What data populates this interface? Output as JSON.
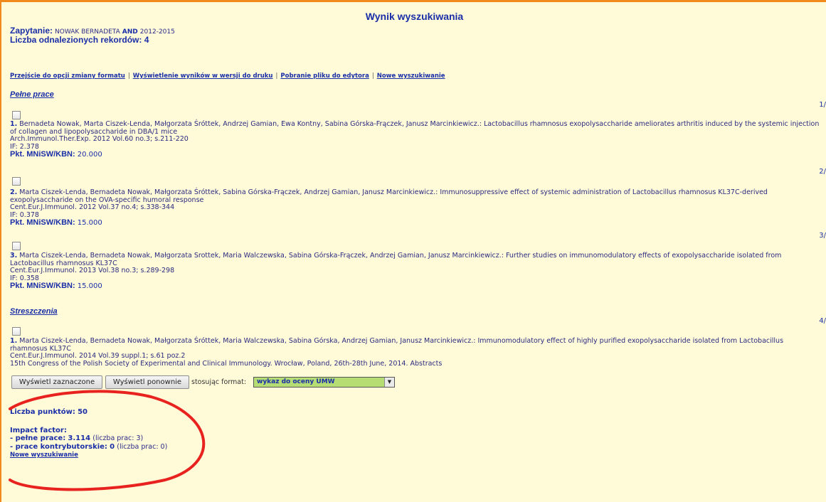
{
  "page_title": "Wynik wyszukiwania",
  "query": {
    "label": "Zapytanie:",
    "author": "NOWAK BERNADETA",
    "operator": "AND",
    "years": "2012-2015"
  },
  "found": {
    "label": "Liczba odnalezionych rekordów:",
    "count": "4"
  },
  "links": [
    "Przejście do opcji zmiany formatu",
    "Wyświetlenie wyników w wersji do druku",
    "Pobranie pliku do edytora",
    "Nowe wyszukiwanie"
  ],
  "link_separator": "|",
  "sections": {
    "full": "Pełne prace",
    "abstracts": "Streszczenia"
  },
  "records": [
    {
      "index_right": "1/",
      "num": "1.",
      "text": "Bernadeta Nowak, Marta Ciszek-Lenda, Małgorzata Śróttek, Andrzej Gamian, Ewa Kontny, Sabina Górska-Frączek, Janusz Marcinkiewicz.: Lactobacillus rhamnosus exopolysaccharide ameliorates arthritis induced by the systemic injection of collagen and lipopolysaccharide in DBA/1 mice",
      "journal": "Arch.Immunol.Ther.Exp. 2012 Vol.60 no.3; s.211-220",
      "if": "IF: 2.378",
      "pkt_label": "Pkt. MNiSW/KBN:",
      "pkt_value": "20.000"
    },
    {
      "index_right": "2/",
      "num": "2.",
      "text": "Marta Ciszek-Lenda, Bernadeta Nowak, Małgorzata Śróttek, Sabina Górska-Frączek, Andrzej Gamian, Janusz Marcinkiewicz.: Immunosuppressive effect of systemic administration of Lactobacillus rhamnosus KL37C-derived exopolysaccharide on the OVA-specific humoral response",
      "journal": "Cent.Eur.J.Immunol. 2012 Vol.37 no.4; s.338-344",
      "if": "IF: 0.378",
      "pkt_label": "Pkt. MNiSW/KBN:",
      "pkt_value": "15.000"
    },
    {
      "index_right": "3/",
      "num": "3.",
      "text": "Marta Ciszek-Lenda, Bernadeta Nowak, Małgorzata Srottek, Maria Walczewska, Sabina Górska-Frączek, Andrzej Gamian, Janusz Marcinkiewicz.: Further studies on immunomodulatory effects of exopolysaccharide isolated from Lactobacillus rhamnosus KL37C",
      "journal": "Cent.Eur.J.Immunol. 2013 Vol.38 no.3; s.289-298",
      "if": "IF: 0.358",
      "pkt_label": "Pkt. MNiSW/KBN:",
      "pkt_value": "15.000"
    },
    {
      "index_right": "4/",
      "num": "1.",
      "text": "Marta Ciszek-Lenda, Bernadeta Nowak, Małgorzata Śróttek, Maria Walczewska, Sabina Górska, Andrzej Gamian, Janusz Marcinkiewicz.: Immunomodulatory effect of highly purified exopolysaccharide isolated from Lactobacillus rhamnosus KL37C",
      "journal": "Cent.Eur.J.Immunol. 2014 Vol.39 suppl.1; s.61 poz.2",
      "extra": "15th Congress of the Polish Society of Experimental and Clinical Immunology. Wrocław, Poland, 26th-28th June, 2014. Abstracts"
    }
  ],
  "controls": {
    "show_selected": "Wyświetl zaznaczone",
    "show_again": "Wyświetl ponownie",
    "format_label": "stosując format:",
    "format_value": "wykaz do oceny UMW"
  },
  "summary": {
    "points_label": "Liczba punktów:",
    "points_value": "50",
    "if_label": "Impact factor:",
    "full_label": "- pełne prace:",
    "full_value": "3.114",
    "full_count": "(liczba prac: 3)",
    "contrib_label": "- prace kontrybutorskie:",
    "contrib_value": "0",
    "contrib_count": "(liczba prac: 0)",
    "new_search": "Nowe wyszukiwanie"
  },
  "colors": {
    "background": "#fffbd8",
    "border": "#f08a1c",
    "link": "#1a2ea8",
    "annotation_oval": "#e8231f",
    "select_bg": "#b6dc74"
  }
}
